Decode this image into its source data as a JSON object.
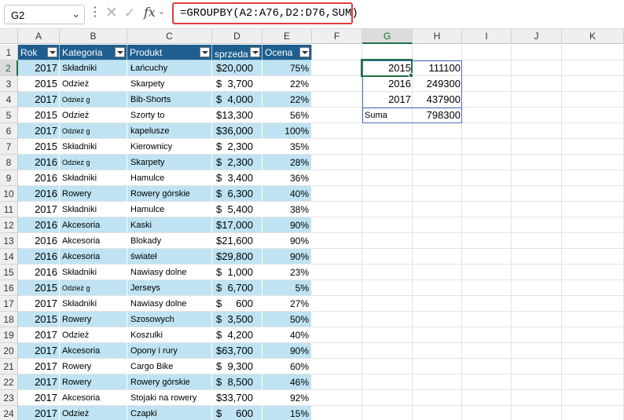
{
  "formula_bar": {
    "name_box": "G2",
    "name_box_arrow": "⌄",
    "dots": "⋮",
    "cancel": "✕",
    "enter": "✓",
    "fx": "fx",
    "fx_arrow": "⌄",
    "formula": "=GROUPBY(A2:A76,D2:D76,SUM)"
  },
  "columns": [
    "A",
    "B",
    "C",
    "D",
    "E",
    "F",
    "G",
    "H",
    "I",
    "J",
    "K"
  ],
  "selected_column": "G",
  "rows": [
    "1",
    "2",
    "3",
    "4",
    "5",
    "6",
    "7",
    "8",
    "9",
    "10",
    "11",
    "12",
    "13",
    "14",
    "15",
    "16",
    "17",
    "18",
    "19",
    "20",
    "21",
    "22",
    "23",
    "24"
  ],
  "selected_row": "2",
  "table": {
    "headers": [
      "Rok",
      "Kategoria",
      "Produkt",
      "sprzeda",
      "Ocena"
    ],
    "rows": [
      [
        "2017",
        "Składniki",
        "Łańcuchy",
        "$20,000",
        "75%"
      ],
      [
        "2015",
        "Odzież",
        "Skarpety",
        "$  3,700",
        "22%"
      ],
      [
        "2017",
        "Odzież       g",
        "Bib-Shorts",
        "$  4,000",
        "22%"
      ],
      [
        "2015",
        "Odzież",
        "Szorty to",
        "$13,300",
        "56%"
      ],
      [
        "2017",
        "Odzież       g",
        "kapelusze",
        "$36,000",
        "100%"
      ],
      [
        "2015",
        "Składniki",
        "Kierownicy",
        "$  2,300",
        "35%"
      ],
      [
        "2016",
        "Odzież       g",
        "Skarpety",
        "$  2,300",
        "28%"
      ],
      [
        "2016",
        "Składniki",
        "Hamulce",
        "$  3,400",
        "36%"
      ],
      [
        "2016",
        "Rowery",
        "Rowery górskie",
        "$  6,300",
        "40%"
      ],
      [
        "2017",
        "Składniki",
        "Hamulce",
        "$  5,400",
        "38%"
      ],
      [
        "2016",
        "Akcesoria",
        "Kaski",
        "$17,000",
        "90%"
      ],
      [
        "2016",
        "Akcesoria",
        "Blokady",
        "$21,600",
        "90%"
      ],
      [
        "2016",
        "Akcesoria",
        "świateł",
        "$29,800",
        "90%"
      ],
      [
        "2016",
        "Składniki",
        "Nawiasy dolne",
        "$  1,000",
        "23%"
      ],
      [
        "2015",
        "Odzież       g",
        "Jerseys",
        "$  6,700",
        "5%"
      ],
      [
        "2017",
        "Składniki",
        "Nawiasy dolne",
        "$     600",
        "27%"
      ],
      [
        "2015",
        "Rowery",
        "Szosowych",
        "$  3,500",
        "50%"
      ],
      [
        "2017",
        "Odzież",
        "Koszulki",
        "$  4,200",
        "40%"
      ],
      [
        "2017",
        "Akcesoria",
        "Opony i rury",
        "$63,700",
        "90%"
      ],
      [
        "2017",
        "Rowery",
        "Cargo Bike",
        "$  9,300",
        "60%"
      ],
      [
        "2017",
        "Rowery",
        "Rowery górskie",
        "$  8,500",
        "46%"
      ],
      [
        "2017",
        "Akcesoria",
        "Stojaki na rowery",
        "$33,700",
        "92%"
      ],
      [
        "2017",
        "Odzież",
        "Czapki",
        "$     600",
        "15%"
      ]
    ]
  },
  "summary": {
    "rows": [
      {
        "label": "2015",
        "value": "111100"
      },
      {
        "label": "2016",
        "value": "249300"
      },
      {
        "label": "2017",
        "value": "437900"
      }
    ],
    "total_label": "Suma",
    "total_value": "798300"
  }
}
